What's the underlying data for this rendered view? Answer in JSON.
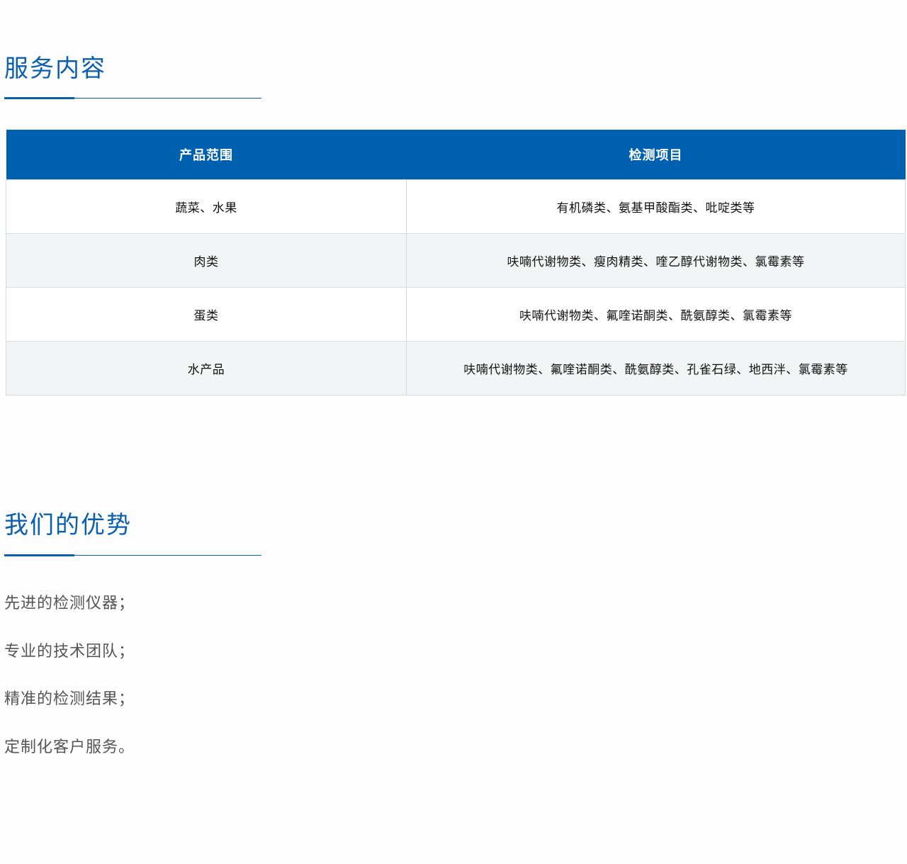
{
  "services": {
    "title": "服务内容",
    "table": {
      "headers": [
        "产品范围",
        "检测项目"
      ],
      "rows": [
        [
          "蔬菜、水果",
          "有机磷类、氨基甲酸酯类、吡啶类等"
        ],
        [
          "肉类",
          "呋喃代谢物类、瘦肉精类、喹乙醇代谢物类、氯霉素等"
        ],
        [
          "蛋类",
          "呋喃代谢物类、氟喹诺酮类、酰氨醇类、氯霉素等"
        ],
        [
          "水产品",
          "呋喃代谢物类、氟喹诺酮类、酰氨醇类、孔雀石绿、地西泮、氯霉素等"
        ]
      ]
    }
  },
  "advantages": {
    "title": "我们的优势",
    "items": [
      "先进的检测仪器；",
      "专业的技术团队；",
      "精准的检测结果；",
      "定制化客户服务。"
    ]
  },
  "colors": {
    "accent": "#0a5fb0",
    "table_header_bg": "#0060b0",
    "row_alt_bg": "#f3f4f6",
    "body_text": "#555555"
  }
}
